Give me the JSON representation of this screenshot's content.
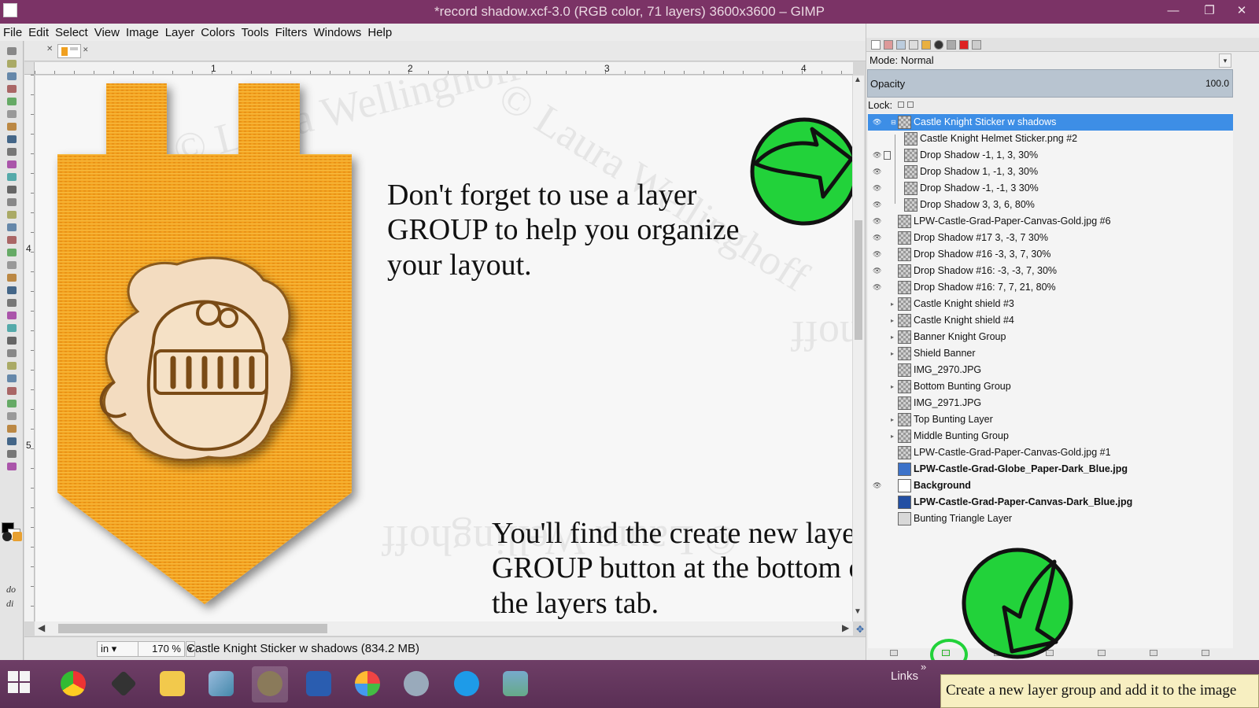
{
  "window": {
    "title": "*record shadow.xcf-3.0 (RGB color, 71 layers) 3600x3600 – GIMP",
    "minimize_glyph": "—",
    "maximize_glyph": "❐",
    "close_glyph": "✕"
  },
  "menu": [
    "File",
    "Edit",
    "Select",
    "View",
    "Image",
    "Layer",
    "Colors",
    "Tools",
    "Filters",
    "Windows",
    "Help"
  ],
  "rulers": {
    "horizontal": [
      "1",
      "2",
      "3",
      "4"
    ],
    "vertical": [
      "4",
      "5"
    ]
  },
  "canvas": {
    "note_top": "Don't forget to use a layer\nGROUP to help you organize\nyour layout.",
    "note_bottom": "You'll find the create new layer\nGROUP button at the bottom of\nthe layers tab.",
    "watermark": "© Laura Wellinghoff"
  },
  "toolbox": {
    "partial_text_1": "do",
    "partial_text_2": "di"
  },
  "status": {
    "unit": "in",
    "zoom": "170 %",
    "message": "Castle Knight Sticker w shadows (834.2 MB)"
  },
  "layers_panel": {
    "mode_label": "Mode:",
    "mode_value": "Normal",
    "opacity_label": "Opacity",
    "opacity_value": "100.0",
    "lock_label": "Lock:",
    "layers": [
      {
        "name": "Castle Knight Sticker w shadows",
        "selected": true,
        "visible": true,
        "indent": 0,
        "group": true
      },
      {
        "name": "Castle Knight Helmet Sticker.png #2",
        "visible": false,
        "indent": 1
      },
      {
        "name": "Drop Shadow -1, 1, 3, 30%",
        "visible": true,
        "indent": 1,
        "chain": true
      },
      {
        "name": "Drop Shadow 1, -1, 3, 30%",
        "visible": true,
        "indent": 1
      },
      {
        "name": "Drop Shadow -1, -1, 3 30%",
        "visible": true,
        "indent": 1
      },
      {
        "name": "Drop Shadow 3, 3, 6, 80%",
        "visible": true,
        "indent": 1
      },
      {
        "name": "LPW-Castle-Grad-Paper-Canvas-Gold.jpg #6",
        "visible": true,
        "indent": 0
      },
      {
        "name": "Drop Shadow #17 3, -3, 7 30%",
        "visible": true,
        "indent": 0
      },
      {
        "name": "Drop Shadow #16 -3, 3, 7, 30%",
        "visible": true,
        "indent": 0
      },
      {
        "name": "Drop Shadow #16: -3, -3, 7, 30%",
        "visible": true,
        "indent": 0
      },
      {
        "name": "Drop Shadow #16: 7, 7, 21, 80%",
        "visible": true,
        "indent": 0
      },
      {
        "name": "Castle Knight shield #3",
        "visible": false,
        "indent": 0,
        "group": true
      },
      {
        "name": "Castle Knight shield #4",
        "visible": false,
        "indent": 0,
        "group": true
      },
      {
        "name": "Banner Knight Group",
        "visible": false,
        "indent": 0,
        "group": true
      },
      {
        "name": "Shield Banner",
        "visible": false,
        "indent": 0,
        "group": true
      },
      {
        "name": "IMG_2970.JPG",
        "visible": false,
        "indent": 0
      },
      {
        "name": "Bottom Bunting Group",
        "visible": false,
        "indent": 0,
        "group": true
      },
      {
        "name": "IMG_2971.JPG",
        "visible": false,
        "indent": 0
      },
      {
        "name": "Top Bunting Layer",
        "visible": false,
        "indent": 0,
        "group": true
      },
      {
        "name": "Middle Bunting Group",
        "visible": false,
        "indent": 0,
        "group": true
      },
      {
        "name": "LPW-Castle-Grad-Paper-Canvas-Gold.jpg #1",
        "visible": false,
        "indent": 0
      },
      {
        "name": "LPW-Castle-Grad-Globe_Paper-Dark_Blue.jpg",
        "visible": false,
        "indent": 0,
        "bold": true,
        "thumb": "blue"
      },
      {
        "name": "Background",
        "visible": true,
        "indent": 0,
        "bold": true,
        "thumb": "white"
      },
      {
        "name": "LPW-Castle-Grad-Paper-Canvas-Dark_Blue.jpg",
        "visible": false,
        "indent": 0,
        "bold": true,
        "thumb": "darkblue"
      },
      {
        "name": "Bunting Triangle Layer",
        "visible": false,
        "indent": 0,
        "thumb": "red"
      }
    ]
  },
  "taskbar": {
    "links_label": "Links",
    "links_chevron": "»",
    "tooltip": "Create a new layer group and add it to the image"
  },
  "colors": {
    "titlebar": "#7b3366",
    "selection": "#3d8ee6",
    "annotation_green": "#22d23a",
    "banner_orange": "#f29a1a"
  }
}
